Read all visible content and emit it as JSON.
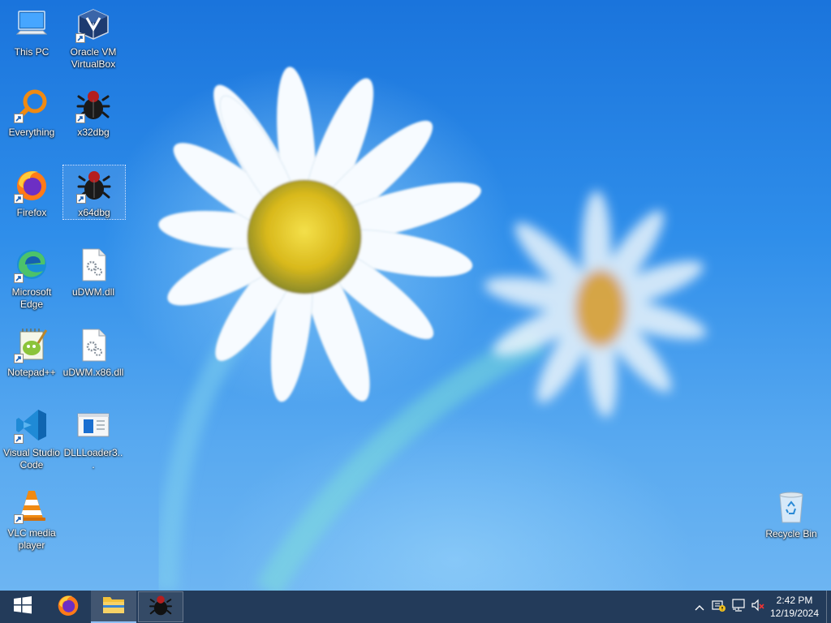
{
  "desktop": {
    "icons": [
      {
        "label": "This PC",
        "icon": "computer-icon"
      },
      {
        "label": "Oracle VM VirtualBox",
        "icon": "virtualbox-icon"
      },
      {
        "label": "Everything",
        "icon": "magnifier-icon"
      },
      {
        "label": "x32dbg",
        "icon": "bug-icon"
      },
      {
        "label": "Firefox",
        "icon": "firefox-icon"
      },
      {
        "label": "x64dbg",
        "icon": "bug-icon"
      },
      {
        "label": "Microsoft Edge",
        "icon": "edge-icon"
      },
      {
        "label": "uDWM.dll",
        "icon": "dll-file-icon"
      },
      {
        "label": "Notepad++",
        "icon": "notepadpp-icon"
      },
      {
        "label": "uDWM.x86.dll",
        "icon": "dll-file-icon"
      },
      {
        "label": "Visual Studio Code",
        "icon": "vscode-icon"
      },
      {
        "label": "DLLLoader3...",
        "icon": "app-window-icon"
      },
      {
        "label": "VLC media player",
        "icon": "vlc-cone-icon"
      },
      {
        "label": "Recycle Bin",
        "icon": "recycle-bin-icon"
      }
    ],
    "selected": "x64dbg"
  },
  "taskbar": {
    "buttons": [
      {
        "name": "start",
        "icon": "windows-logo-icon"
      },
      {
        "name": "firefox",
        "icon": "firefox-icon"
      },
      {
        "name": "file-explorer",
        "icon": "folder-icon"
      },
      {
        "name": "x64dbg",
        "icon": "bug-icon"
      }
    ],
    "tray": {
      "icons": [
        "chevron-up-icon",
        "security-icon",
        "network-icon",
        "volume-muted-icon"
      ],
      "time": "2:42 PM",
      "date": "12/19/2024"
    }
  },
  "colors": {
    "taskbar": "#233b5a",
    "wallpaper": "#2f8eea"
  }
}
